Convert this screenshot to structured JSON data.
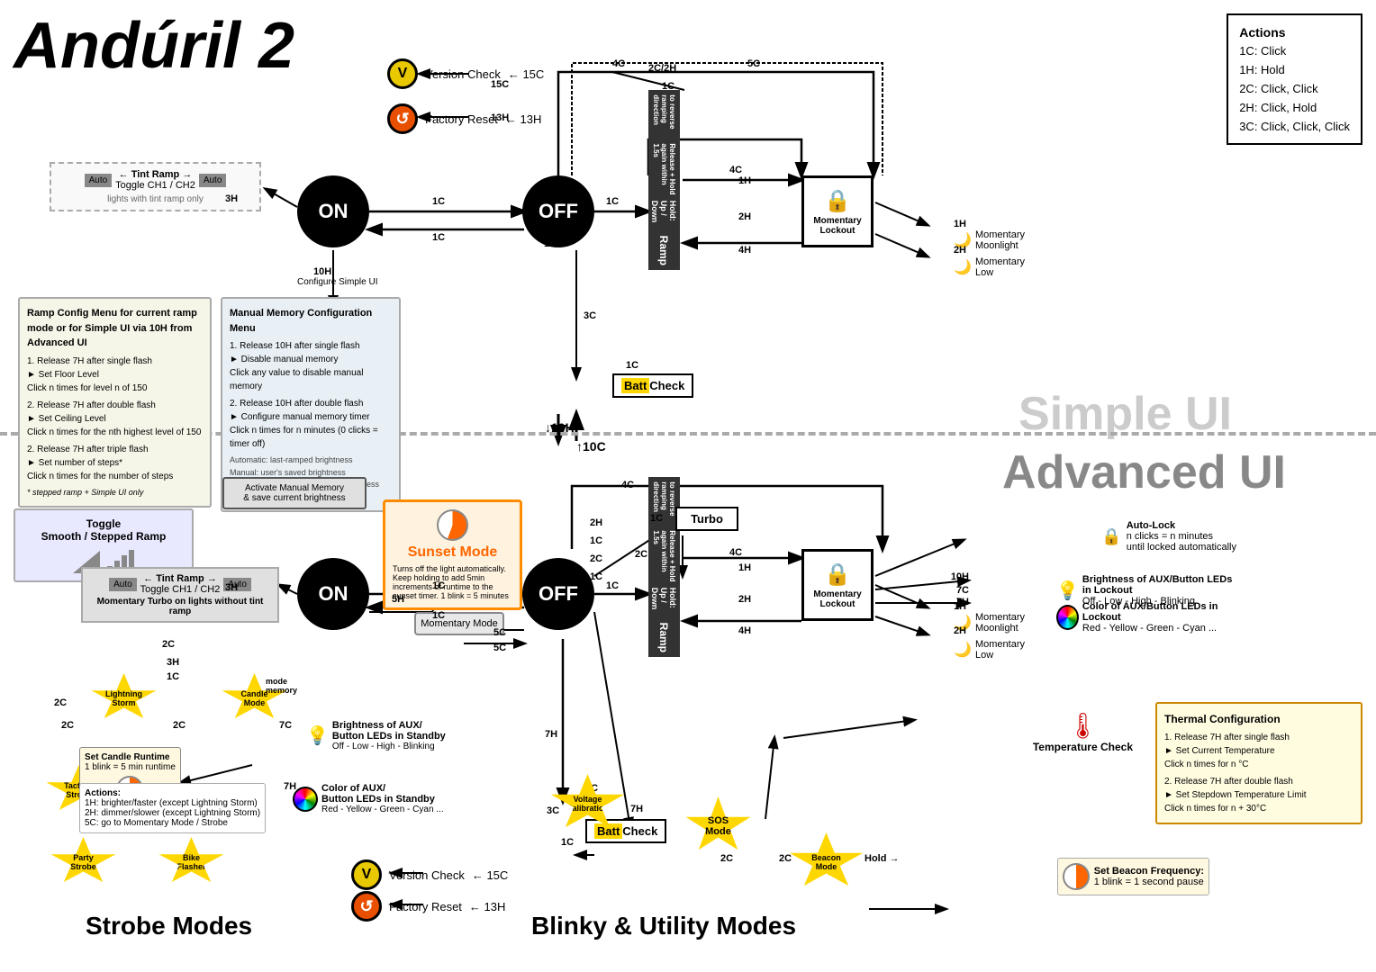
{
  "title": "Andúril 2",
  "actions": {
    "title": "Actions",
    "items": [
      "1C: Click",
      "1H: Hold",
      "2C: Click, Click",
      "2H: Click, Hold",
      "3C: Click, Click, Click"
    ]
  },
  "labels": {
    "simple_ui": "Simple UI",
    "advanced_ui": "Advanced UI",
    "on": "ON",
    "off": "OFF",
    "ramp": "Ramp",
    "momentary_lockout": "Momentary Lockout",
    "batt_check": "BattCheck",
    "version_check": "Version Check",
    "factory_reset": "Factory Reset",
    "turbo": "Turbo",
    "sunset_mode": "Sunset Mode",
    "momentary_mode": "Momentary Mode",
    "toggle_smooth_stepped": "Toggle\nSmooth / Stepped Ramp",
    "strobe_modes": "Strobe Modes",
    "blinky_modes": "Blinky & Utility Modes",
    "tint_ramp": "← Tint Ramp →\nToggle CH1 / CH2",
    "tint_ramp_note": "lights with tint ramp only",
    "momentary_turbo": "Momentary Turbo\non lights without tint ramp",
    "auto": "Auto",
    "autolock": "Auto-Lock\nn clicks = n minutes\nuntil locked automatically",
    "aux_brightness": "Brightness of AUX/Button LEDs in Lockout\nOff - Low - High - Blinking",
    "aux_color": "Color of AUX/Button LEDs in Lockout\nRed - Yellow - Green - Cyan ...",
    "aux_brightness_standby": "Brightness of AUX/\nButton LEDs in Standby\nOff - Low - High - Blinking",
    "aux_color_standby": "Color of AUX/\nButton LEDs in Standby\nRed - Yellow - Green - Cyan ...",
    "momentary_moonlight": "Momentary\nMoonlight",
    "momentary_low": "Momentary\nLow",
    "temp_check": "Temperature\nCheck",
    "beacon_freq": "Set Beacon Frequency:\n1 blink = 1 second pause",
    "voltage_calibration": "Voltage\nCalibration",
    "sos": "SOS\nMode",
    "beacon": "Beacon\nMode",
    "lightning": "Lightning\nStorm",
    "candle": "Candle\nMode",
    "tactical": "Tactical\nStrobe",
    "party": "Party\nStrobe",
    "bike": "Bike\nFlasher",
    "activate_mem": "Activate Manual Memory\n& save current brightness",
    "sunset_desc": "Turns off the light automatically.\nKeep holding to add 5min\nincrements of runtime\nto the sunset timer.\n1 blink = 5 minutes",
    "configure_simple_ui": "Configure Simple UI",
    "arrow_10H": "10H",
    "arrow_10C": "10C",
    "hold_up_down": "Hold: Up / Down\nRelease + Hold again within 1.5s\nto reverse ramping direction"
  },
  "ramp_config": {
    "title": "Ramp Config Menu for current ramp mode\nor for Simple UI via 10H from Advanced UI",
    "items": [
      "1. Release 7H after single flash\n► Set Floor Level\nClick n times for level n of 150",
      "2. Release 7H after double flash\n► Set Ceiling Level\nClick n times for the nth highest level of 150",
      "2. Release 7H after triple flash\n► Set number of steps*\nClick n times for the number of steps"
    ],
    "note": "* stepped ramp + Simple UI only"
  },
  "manual_mem": {
    "title": "Manual Memory Configuration Menu",
    "items": [
      "1. Release 10H after single flash\n► Disable manual memory\nClick any value to disable manual memory",
      "2. Release 10H after double flash\n► Configure manual memory timer\nClick n times for n minutes (0 clicks = timer off)"
    ],
    "note": "Automatic: last-ramped brightness\nManual: user's saved brightness\nHybrid: remember last-ramped brightness\nfor n minutes"
  },
  "thermal_config": {
    "title": "Thermal Configuration",
    "items": [
      "1. Release 7H after single flash\n► Set Current Temperature\nClick n times for n °C",
      "2. Release 7H after double flash\n► Set Stepdown Temperature Limit\nClick n times for n + 30°C"
    ]
  },
  "candle_runtime": {
    "title": "Set Candle Runtime",
    "note": "1 blink = 5 min runtime"
  },
  "strobe_actions": {
    "title": "Actions:",
    "items": [
      "1H: brighter/faster (except Lightning Storm)",
      "2H: dimmer/slower (except Lightning Storm)",
      "5C: go to Momentary Mode / Strobe"
    ]
  },
  "nav": {
    "simple_transitions": [
      {
        "label": "1C",
        "from": "on",
        "to": "off"
      },
      {
        "label": "1C",
        "from": "off",
        "to": "on"
      },
      {
        "label": "3H",
        "from": "on",
        "to": "tint"
      },
      {
        "label": "1H",
        "from": "off",
        "to": "ramp_up"
      },
      {
        "label": "2H",
        "from": "off",
        "to": "ramp_down"
      },
      {
        "label": "4C",
        "from": "off",
        "to": "lockout"
      },
      {
        "label": "4H",
        "from": "lockout",
        "to": "off"
      },
      {
        "label": "1H",
        "from": "lockout",
        "to": "moon"
      },
      {
        "label": "2H",
        "from": "lockout",
        "to": "low"
      },
      {
        "label": "3C",
        "from": "off",
        "to": "battcheck"
      },
      {
        "label": "1C",
        "from": "battcheck",
        "to": "off"
      }
    ]
  }
}
